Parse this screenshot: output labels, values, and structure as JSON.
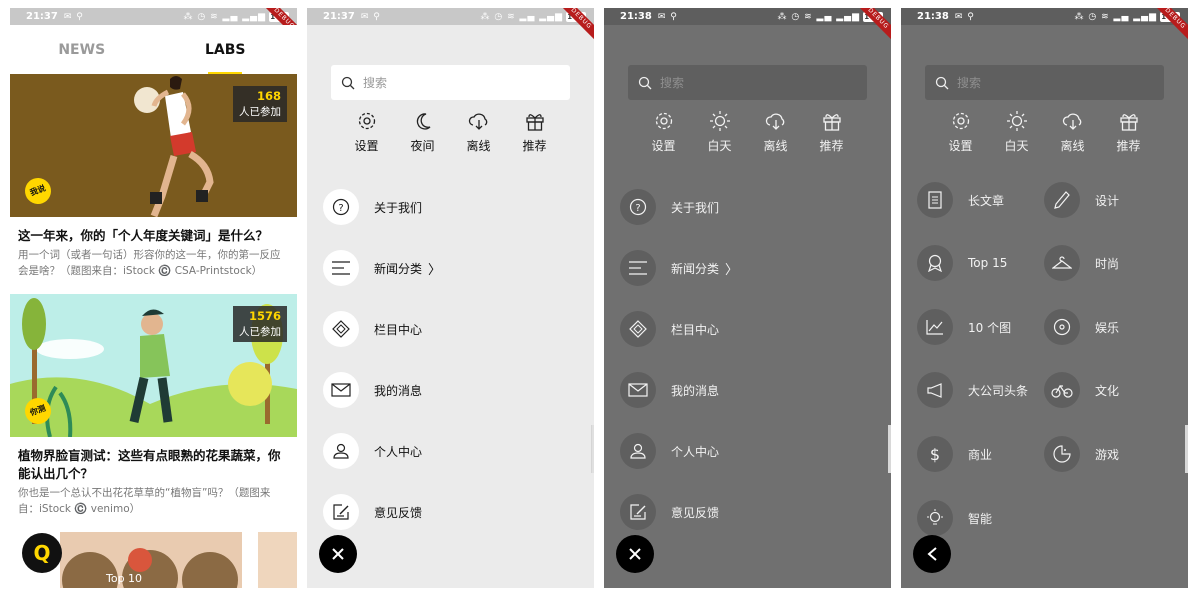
{
  "status_bar": {
    "phone1_time": "21:37",
    "phone2_time": "21:37",
    "phone3_time": "21:38",
    "phone4_time": "21:38",
    "battery": "100",
    "debug_banner": "DEBUG"
  },
  "feed": {
    "tabs": [
      "NEWS",
      "LABS"
    ],
    "active_tab": "LABS",
    "cards": [
      {
        "count": "168",
        "count_label": "人已参加",
        "tag": "我说",
        "title": "这一年来，你的「个人年度关键词」是什么？",
        "desc": "用一个词（或者一句话）形容你的这一年，你的第一反应会是啥？（题图来自：iStock ©️ CSA-Printstock）"
      },
      {
        "count": "1576",
        "count_label": "人已参加",
        "tag": "你测",
        "title": "植物界脸盲测试：这些有点眼熟的花果蔬菜，你能认出几个？",
        "desc": "你也是一个总认不出花花草草的“植物盲”吗？（题图来自：iStock ©️ venimo）"
      }
    ],
    "third_card_label": "Top 10",
    "fab_label": "Q"
  },
  "search_placeholder": "搜索",
  "menu_light": {
    "quick": [
      {
        "label": "设置",
        "icon": "gear-icon"
      },
      {
        "label": "夜间",
        "icon": "moon-icon"
      },
      {
        "label": "离线",
        "icon": "cloud-download-icon"
      },
      {
        "label": "推荐",
        "icon": "gift-icon"
      }
    ],
    "items": [
      {
        "label": "关于我们",
        "icon": "question-icon"
      },
      {
        "label": "新闻分类",
        "icon": "list-icon"
      },
      {
        "label": "栏目中心",
        "icon": "diamond-icon"
      },
      {
        "label": "我的消息",
        "icon": "mail-icon"
      },
      {
        "label": "个人中心",
        "icon": "person-icon"
      },
      {
        "label": "意见反馈",
        "icon": "feedback-icon"
      }
    ]
  },
  "menu_dark": {
    "quick": [
      {
        "label": "设置",
        "icon": "gear-icon"
      },
      {
        "label": "白天",
        "icon": "sun-icon"
      },
      {
        "label": "离线",
        "icon": "cloud-download-icon"
      },
      {
        "label": "推荐",
        "icon": "gift-icon"
      }
    ]
  },
  "categories": {
    "left": [
      {
        "label": "长文章",
        "icon": "document-icon"
      },
      {
        "label": "Top 15",
        "icon": "medal-icon"
      },
      {
        "label": "10 个图",
        "icon": "chart-icon"
      },
      {
        "label": "大公司头条",
        "icon": "megaphone-icon"
      },
      {
        "label": "商业",
        "icon": "dollar-icon"
      },
      {
        "label": "智能",
        "icon": "bulb-icon"
      }
    ],
    "right": [
      {
        "label": "设计",
        "icon": "pen-icon"
      },
      {
        "label": "时尚",
        "icon": "hanger-icon"
      },
      {
        "label": "娱乐",
        "icon": "vinyl-icon"
      },
      {
        "label": "文化",
        "icon": "bicycle-icon"
      },
      {
        "label": "游戏",
        "icon": "game-icon"
      }
    ]
  },
  "colors": {
    "accent": "#ffd700",
    "dark_bg": "#707070",
    "light_bg": "#ebebeb"
  }
}
